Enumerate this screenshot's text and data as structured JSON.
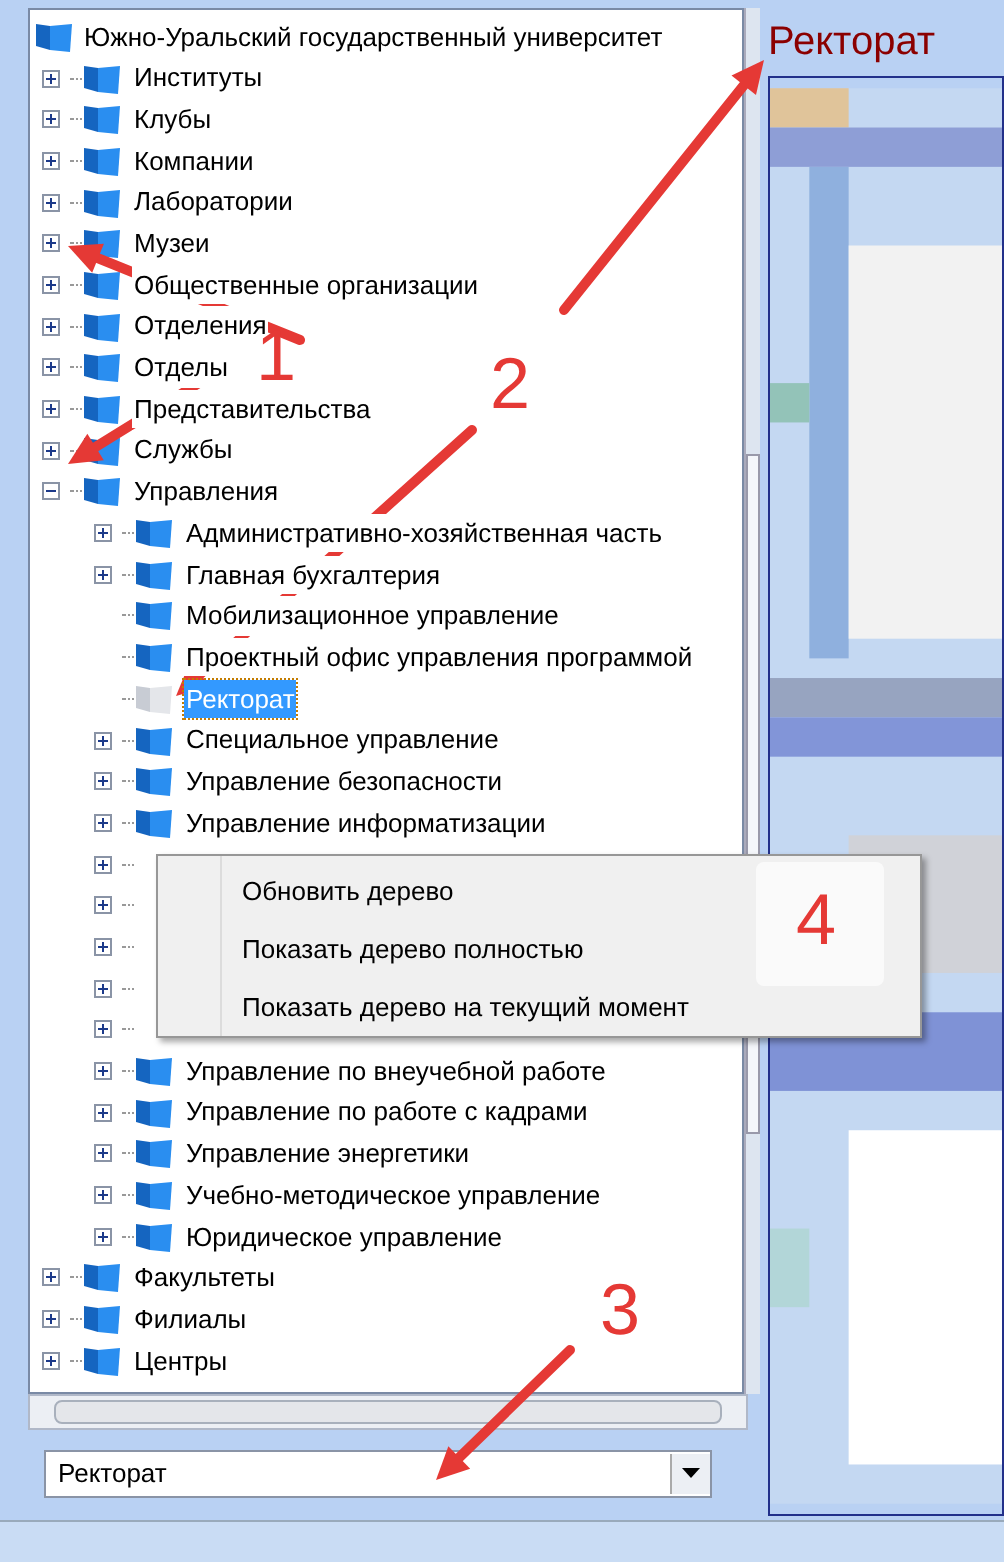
{
  "tree": {
    "label": "Южно-Уральский государственный университет",
    "children": [
      {
        "label": "Институты",
        "expanded": false
      },
      {
        "label": "Клубы",
        "expanded": false
      },
      {
        "label": "Компании",
        "expanded": false
      },
      {
        "label": "Лаборатории",
        "expanded": false
      },
      {
        "label": "Музеи",
        "expanded": false
      },
      {
        "label": "Общественные организации",
        "expanded": false
      },
      {
        "label": "Отделения",
        "expanded": false
      },
      {
        "label": "Отделы",
        "expanded": false
      },
      {
        "label": "Представительства",
        "expanded": false
      },
      {
        "label": "Службы",
        "expanded": false
      },
      {
        "label": "Управления",
        "expanded": true,
        "children": [
          {
            "label": "Административно-хозяйственная часть",
            "expandable": true,
            "selected": false
          },
          {
            "label": "Главная бухгалтерия",
            "expandable": true,
            "selected": false
          },
          {
            "label": "Мобилизационное управление",
            "expandable": false,
            "selected": false
          },
          {
            "label": "Проектный офис управления программой",
            "expandable": false,
            "selected": false
          },
          {
            "label": "Ректорат",
            "expandable": false,
            "selected": true
          },
          {
            "label": "Специальное управление",
            "expandable": true,
            "selected": false
          },
          {
            "label": "Управление безопасности",
            "expandable": true,
            "selected": false
          },
          {
            "label": "Управление информатизации",
            "expandable": true,
            "selected": false
          },
          {
            "expandable": true
          },
          {
            "expandable": true
          },
          {
            "expandable": true
          },
          {
            "expandable": true
          },
          {
            "expandable": true
          },
          {
            "label": "Управление по внеучебной работе",
            "expandable": true,
            "selected": false
          },
          {
            "label": "Управление по работе с кадрами",
            "expandable": true,
            "selected": false
          },
          {
            "label": "Управление энергетики",
            "expandable": true,
            "selected": false
          },
          {
            "label": "Учебно-методическое управление",
            "expandable": true,
            "selected": false
          },
          {
            "label": "Юридическое управление",
            "expandable": true,
            "selected": false
          }
        ]
      },
      {
        "label": "Факультеты",
        "expanded": false
      },
      {
        "label": "Филиалы",
        "expanded": false
      },
      {
        "label": "Центры",
        "expanded": false
      }
    ]
  },
  "combo": {
    "value": "Ректорат"
  },
  "panel": {
    "title": "Ректорат"
  },
  "context_menu": [
    "Обновить дерево",
    "Показать дерево полностью",
    "Показать дерево на текущий момент"
  ],
  "annotations": [
    "1",
    "2",
    "3",
    "4"
  ]
}
